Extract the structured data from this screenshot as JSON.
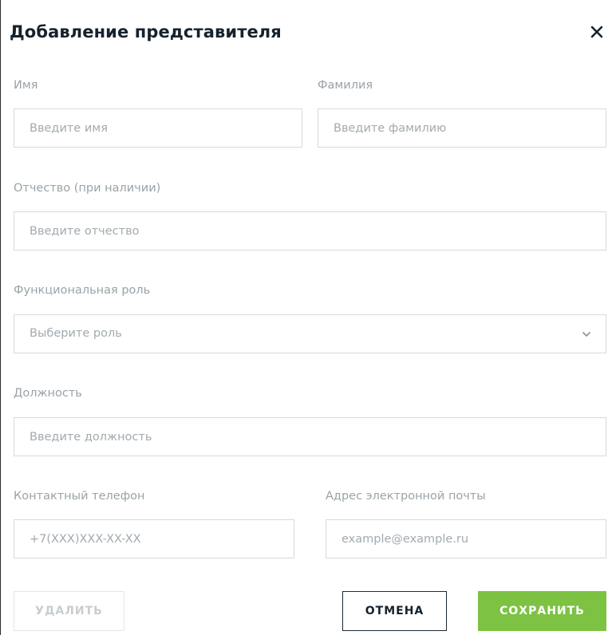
{
  "dialog": {
    "title": "Добавление представителя",
    "close_icon": "close-icon"
  },
  "fields": {
    "first_name": {
      "label": "Имя",
      "placeholder": "Введите имя"
    },
    "last_name": {
      "label": "Фамилия",
      "placeholder": "Введите фамилию"
    },
    "patronymic": {
      "label": "Отчество  (при наличии)",
      "placeholder": "Введите отчество"
    },
    "role": {
      "label": "Функциональная роль",
      "placeholder": "Выберите роль",
      "icon": "chevron-down-icon"
    },
    "position": {
      "label": "Должность",
      "placeholder": "Введите должность"
    },
    "phone": {
      "label": "Контактный телефон",
      "placeholder": "+7(XXX)XXX-XX-XX"
    },
    "email": {
      "label": "Адрес электронной почты",
      "placeholder": "example@example.ru"
    }
  },
  "buttons": {
    "delete": "УДАЛИТЬ",
    "cancel": "ОТМЕНА",
    "save": "СОХРАНИТЬ"
  },
  "colors": {
    "accent": "#7dc243",
    "title": "#16222c",
    "label": "#9aa3a8",
    "border": "#d6d9db"
  }
}
